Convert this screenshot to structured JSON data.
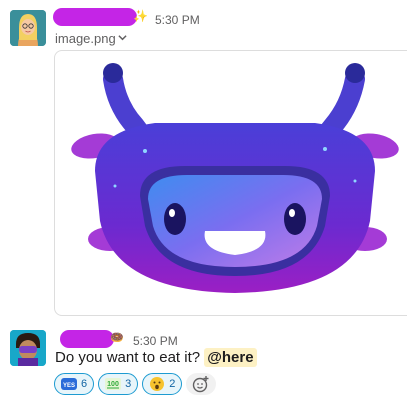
{
  "messages": [
    {
      "time": "5:30 PM",
      "attachment_name": "image.png"
    },
    {
      "time": "5:30 PM",
      "text": "Do you want to eat it?",
      "mention": "@here",
      "reactions": [
        {
          "emoji": "yes-emoji",
          "count": "6"
        },
        {
          "emoji": "100-emoji",
          "count": "3"
        },
        {
          "emoji": "hushed-face-emoji",
          "count": "2"
        }
      ]
    }
  ]
}
